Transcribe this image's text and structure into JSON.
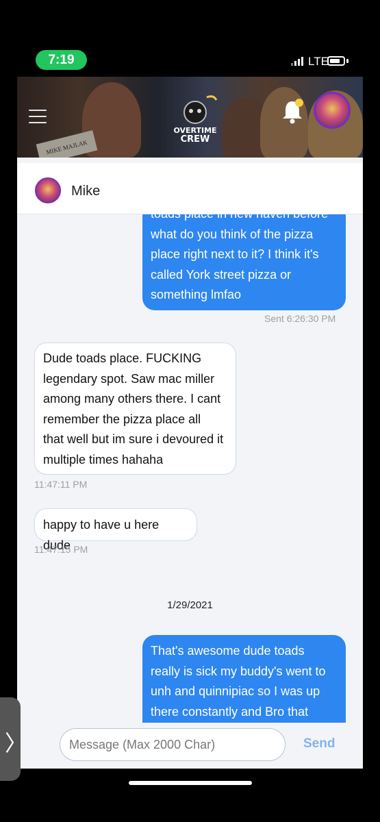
{
  "status_bar": {
    "time": "7:19",
    "network": "LTE"
  },
  "header": {
    "logo_text_line1": "OVERTIME",
    "logo_text_line2": "CREW",
    "sign_text": "MIKE MAJLAK"
  },
  "chat": {
    "contact_name": "Mike",
    "messages": [
      {
        "from": "me",
        "lines": [
          "toads place in new haven before",
          "what do you think of the pizza",
          "place right next to it? I think it's",
          "called York street pizza or",
          "something lmfao"
        ],
        "meta": "Sent 6:26:30 PM"
      },
      {
        "from": "them",
        "lines": [
          "Dude toads place. FUCKING",
          "legendary spot. Saw mac miller",
          "among many others there. I cant",
          "remember the pizza place all",
          "that well but im sure i devoured it",
          "multiple times hahaha"
        ],
        "meta": "11:47:11 PM"
      },
      {
        "from": "them",
        "lines": [
          "happy to have u here dude"
        ],
        "meta": "11:47:15 PM"
      },
      {
        "from": "me",
        "lines": [
          "That's awesome dude toads",
          "really is sick my buddy's went to",
          "unh and quinnipiac so I was up",
          "there constantly and Bro that"
        ]
      }
    ],
    "date_divider": "1/29/2021"
  },
  "composer": {
    "placeholder": "Message (Max 2000 Char)",
    "send_label": "Send"
  },
  "side_tab": {
    "glyph": "〉"
  },
  "colors": {
    "sent_bubble": "#2e86f0",
    "send_text": "#7fb3ee",
    "status_time": "#22c55e"
  }
}
